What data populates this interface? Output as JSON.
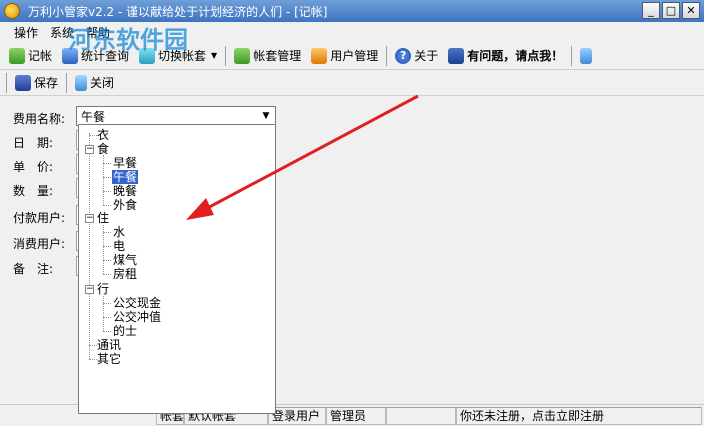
{
  "window": {
    "title": "万利小管家v2.2 - 谨以献给处于计划经济的人们 - [记帐]",
    "buttons": [
      "_",
      "□",
      "✕"
    ]
  },
  "menu": {
    "items": [
      "操作",
      "系统",
      "帮助"
    ]
  },
  "toolbar": {
    "items": [
      {
        "label": "记帐",
        "icon": "ledger-icon"
      },
      {
        "label": "统计查询",
        "icon": "search-stats-icon"
      },
      {
        "label": "切换帐套",
        "icon": "switch-account-icon"
      },
      {
        "label": "帐套管理",
        "icon": "account-manage-icon"
      },
      {
        "label": "用户管理",
        "icon": "users-icon"
      },
      {
        "label": "关于",
        "icon": "help-icon"
      },
      {
        "label": "有问题，请点我！",
        "icon": "book-icon"
      }
    ]
  },
  "toolbar2": {
    "save_label": "保存",
    "close_label": "关闭"
  },
  "form": {
    "labels": {
      "expense_name": "费用名称:",
      "date": "日　期:",
      "unit_price": "单　价:",
      "quantity": "数　量:",
      "payer": "付款用户:",
      "consumer": "消费用户:",
      "remark": "备　注:"
    },
    "expense_value": "午餐"
  },
  "tree": {
    "clothing": "衣",
    "food": "食",
    "food_children": [
      "早餐",
      "午餐",
      "晚餐",
      "外食"
    ],
    "housing": "住",
    "housing_children": [
      "水",
      "电",
      "煤气",
      "房租"
    ],
    "transport": "行",
    "transport_children": [
      "公交现金",
      "公交冲值",
      "的士"
    ],
    "communication": "通讯",
    "other": "其它"
  },
  "watermark": {
    "text": "河东软件园"
  },
  "status": {
    "cells": [
      "帐套",
      "默认帐套",
      "登录用户",
      "管理员",
      "",
      "你还未注册，点击立即注册"
    ]
  },
  "colors": {
    "titlebar": "#3d74c0",
    "selection": "#3366cc",
    "arrow": "#e02020",
    "watermark": "#1a8ad8"
  }
}
